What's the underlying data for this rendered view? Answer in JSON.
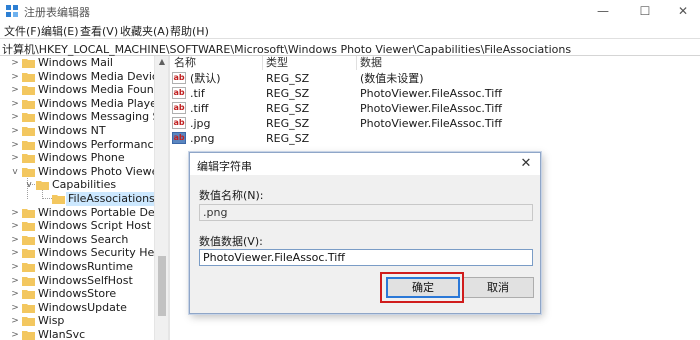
{
  "window": {
    "title": "注册表编辑器",
    "controls": {
      "minimize": "—",
      "maximize": "☐",
      "close": "✕"
    }
  },
  "menubar": {
    "items": [
      {
        "label": "文件(F)"
      },
      {
        "label": "编辑(E)"
      },
      {
        "label": "查看(V)"
      },
      {
        "label": "收藏夹(A)"
      },
      {
        "label": "帮助(H)"
      }
    ]
  },
  "address": {
    "path": "计算机\\HKEY_LOCAL_MACHINE\\SOFTWARE\\Microsoft\\Windows Photo Viewer\\Capabilities\\FileAssociations"
  },
  "tree": {
    "items": [
      {
        "label": "Windows Mail",
        "expander": ">"
      },
      {
        "label": "Windows Media Device M",
        "expander": ">"
      },
      {
        "label": "Windows Media Foundati",
        "expander": ">"
      },
      {
        "label": "Windows Media Player N",
        "expander": ">"
      },
      {
        "label": "Windows Messaging Sub",
        "expander": ">"
      },
      {
        "label": "Windows NT",
        "expander": ">"
      },
      {
        "label": "Windows Performance To",
        "expander": ">"
      },
      {
        "label": "Windows Phone",
        "expander": ">"
      },
      {
        "label": "Windows Photo Viewer",
        "expander": "v"
      },
      {
        "label": "Capabilities",
        "expander": "v"
      },
      {
        "label": "FileAssociations",
        "expander": ""
      },
      {
        "label": "Windows Portable Device",
        "expander": ">"
      },
      {
        "label": "Windows Script Host",
        "expander": ">"
      },
      {
        "label": "Windows Search",
        "expander": ">"
      },
      {
        "label": "Windows Security Health",
        "expander": ">"
      },
      {
        "label": "WindowsRuntime",
        "expander": ">"
      },
      {
        "label": "WindowsSelfHost",
        "expander": ">"
      },
      {
        "label": "WindowsStore",
        "expander": ">"
      },
      {
        "label": "WindowsUpdate",
        "expander": ">"
      },
      {
        "label": "Wisp",
        "expander": ">"
      },
      {
        "label": "WlanSvc",
        "expander": ">"
      }
    ]
  },
  "values": {
    "headers": {
      "name": "名称",
      "type": "类型",
      "data": "数据"
    },
    "rows": [
      {
        "icon": "ab",
        "name": "(默认)",
        "type": "REG_SZ",
        "data": "(数值未设置)"
      },
      {
        "icon": "ab",
        "name": ".tif",
        "type": "REG_SZ",
        "data": "PhotoViewer.FileAssoc.Tiff"
      },
      {
        "icon": "ab",
        "name": ".tiff",
        "type": "REG_SZ",
        "data": "PhotoViewer.FileAssoc.Tiff"
      },
      {
        "icon": "ab",
        "name": ".jpg",
        "type": "REG_SZ",
        "data": "PhotoViewer.FileAssoc.Tiff"
      },
      {
        "icon": "ab",
        "name": ".png",
        "type": "REG_SZ",
        "data": ""
      }
    ]
  },
  "dialog": {
    "title": "编辑字符串",
    "close": "✕",
    "name_label": "数值名称(N):",
    "name_value": ".png",
    "data_label": "数值数据(V):",
    "data_value": "PhotoViewer.FileAssoc.Tiff",
    "ok_label": "确定",
    "cancel_label": "取消"
  },
  "colors": {
    "highlight": "#d01c1c",
    "selection": "#cce8ff",
    "folder": "#f3c75f"
  }
}
